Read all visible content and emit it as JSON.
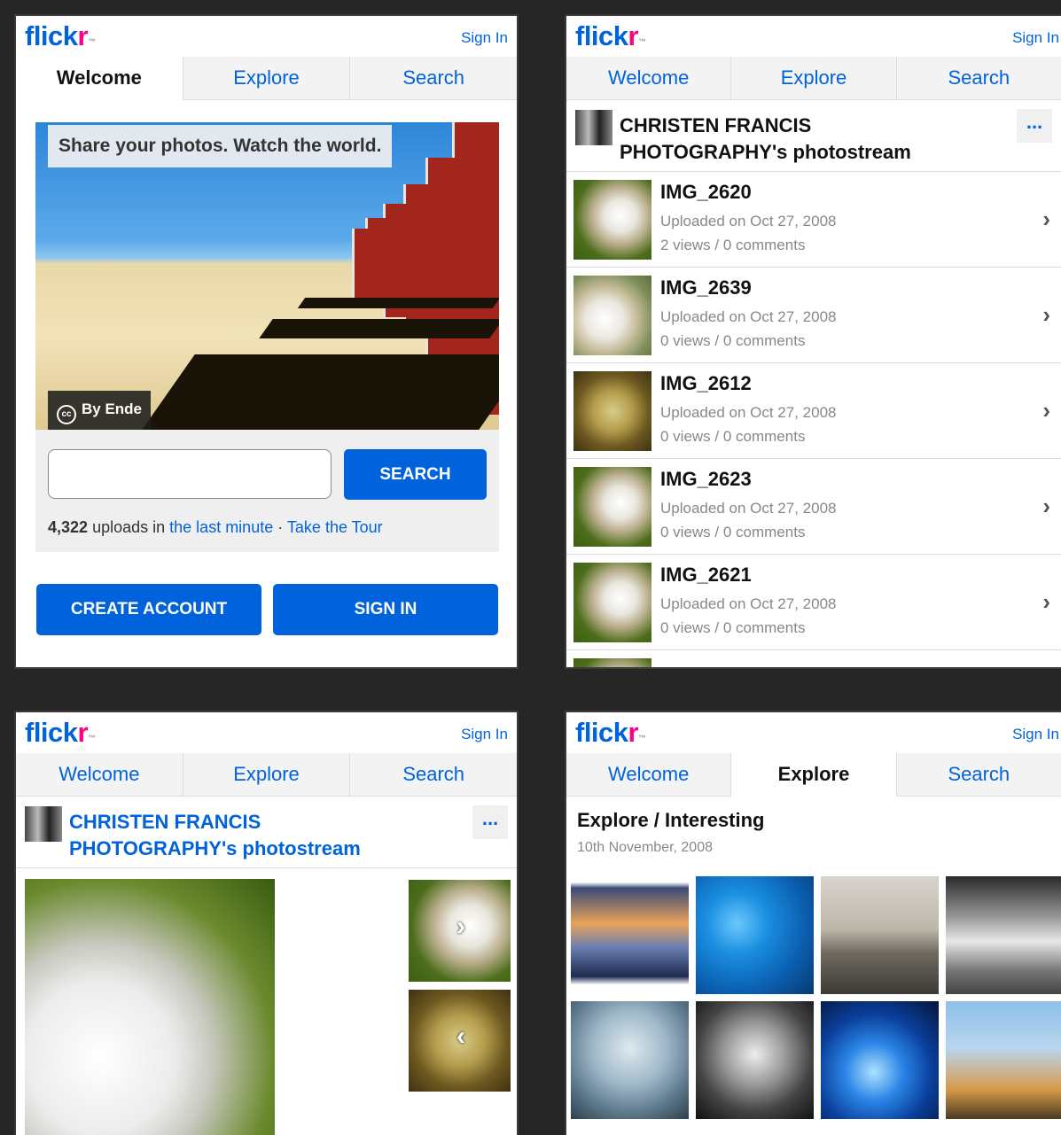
{
  "logo": {
    "part1": "flick",
    "part2": "r",
    "tm": "™"
  },
  "signin": "Sign In",
  "tabs": [
    "Welcome",
    "Explore",
    "Search"
  ],
  "welcome": {
    "hero_title": "Share your photos. Watch the world.",
    "hero_credit": "By Ende",
    "cc_icon": "cc",
    "search_button": "SEARCH",
    "search_value": "",
    "uploads_count": "4,322",
    "uploads_text": "uploads in",
    "last_minute_link": "the last minute",
    "separator": "·",
    "tour_link": "Take the Tour",
    "create_account": "CREATE ACCOUNT",
    "sign_in_button": "SIGN IN"
  },
  "stream": {
    "title_line1": "CHRISTEN FRANCIS",
    "title_line2": "PHOTOGRAPHY's photostream",
    "more": "...",
    "items": [
      {
        "title": "IMG_2620",
        "uploaded": "Uploaded on Oct 27, 2008",
        "stats": "2 views / 0 comments"
      },
      {
        "title": "IMG_2639",
        "uploaded": "Uploaded on Oct 27, 2008",
        "stats": "0 views / 0 comments"
      },
      {
        "title": "IMG_2612",
        "uploaded": "Uploaded on Oct 27, 2008",
        "stats": "0 views / 0 comments"
      },
      {
        "title": "IMG_2623",
        "uploaded": "Uploaded on Oct 27, 2008",
        "stats": "0 views / 0 comments"
      },
      {
        "title": "IMG_2621",
        "uploaded": "Uploaded on Oct 27, 2008",
        "stats": "0 views / 0 comments"
      }
    ]
  },
  "explore": {
    "title": "Explore / Interesting",
    "date": "10th November, 2008"
  },
  "colors": {
    "brand_blue": "#0063dc",
    "brand_pink": "#ff0084"
  }
}
